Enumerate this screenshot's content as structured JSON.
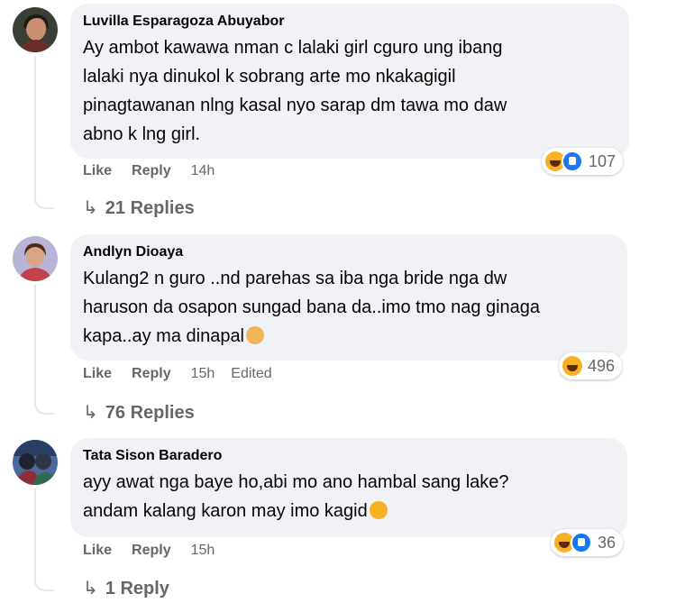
{
  "comments": [
    {
      "author": "Luvilla Esparagoza Abuyabor",
      "lines": [
        "Ay ambot kawawa nman c lalaki girl cguro ung ibang",
        "lalaki nya dinukol k sobrang arte mo nkakagigil",
        "pinagtawanan nlng kasal nyo sarap dm tawa mo daw",
        "abno k lng girl."
      ],
      "like": "Like",
      "reply": "Reply",
      "time": "14h",
      "reaction_count": "107",
      "replies": "21 Replies"
    },
    {
      "author": "Andlyn Dioaya",
      "lines": [
        "Kulang2 n guro ..nd parehas sa iba nga bride nga dw",
        "haruson da osapon sungad bana da..imo tmo nag ginaga",
        "kapa..ay ma dinapal"
      ],
      "like": "Like",
      "reply": "Reply",
      "time": "15h",
      "edited": "Edited",
      "reaction_count": "496",
      "replies": "76 Replies"
    },
    {
      "author": "Tata Sison Baradero",
      "lines": [
        "ayy awat nga baye ho,abi mo ano hambal sang lake?",
        "andam kalang karon may imo kagid"
      ],
      "like": "Like",
      "reply": "Reply",
      "time": "15h",
      "reaction_count": "36",
      "replies": "1 Reply"
    }
  ],
  "icons": {
    "reply_arrow": "↳"
  }
}
